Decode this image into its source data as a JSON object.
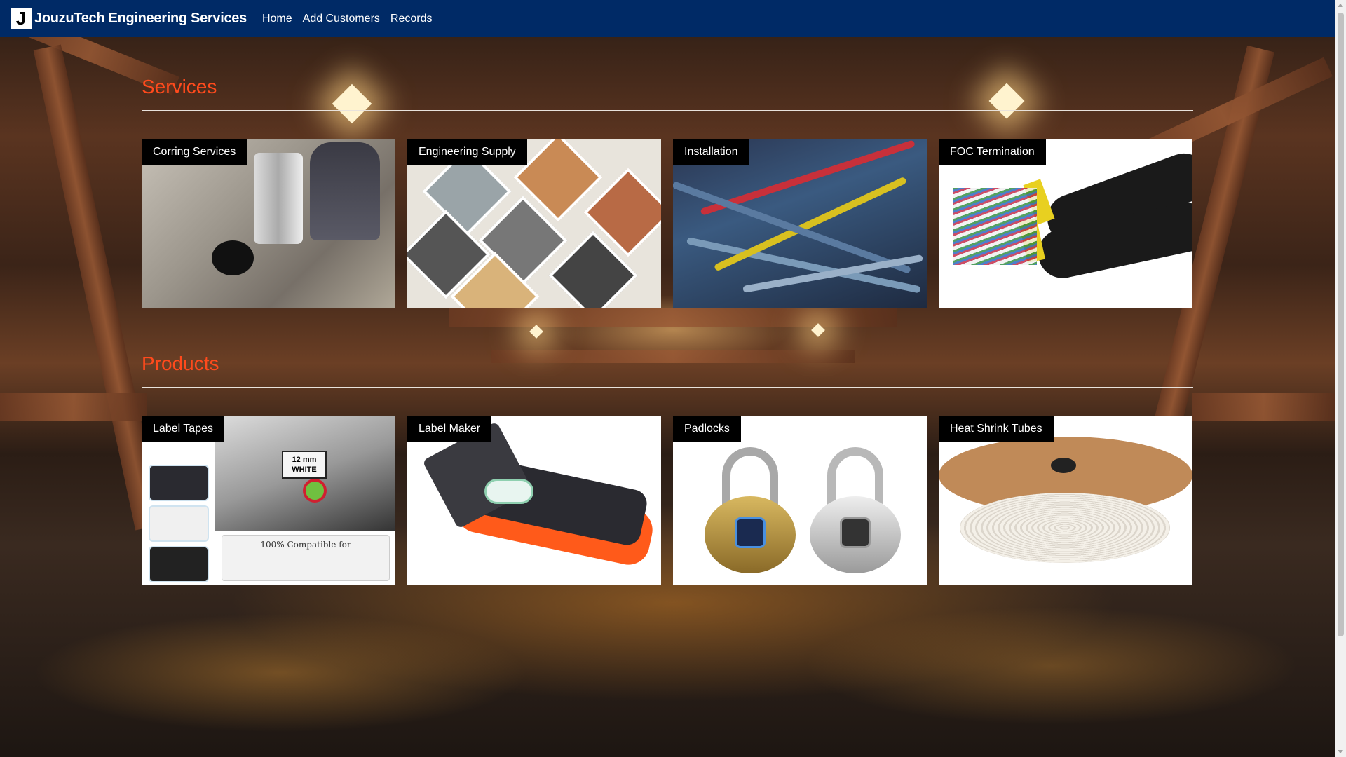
{
  "navbar": {
    "logo_letter": "J",
    "brand": "JouzuTech Engineering Services",
    "links": [
      "Home",
      "Add Customers",
      "Records"
    ]
  },
  "services": {
    "title": "Services",
    "cards": [
      "Corring Services",
      "Engineering Supply",
      "Installation",
      "FOC Termination"
    ]
  },
  "products": {
    "title": "Products",
    "cards": [
      "Label Tapes",
      "Label Maker",
      "Padlocks",
      "Heat Shrink Tubes"
    ]
  },
  "product_details": {
    "tape_label_size": "12 mm",
    "tape_label_color": "WHITE",
    "tape_compat": "100% Compatible for"
  },
  "colors": {
    "navbar": "#002a66",
    "section_title": "#ff4a1c"
  }
}
